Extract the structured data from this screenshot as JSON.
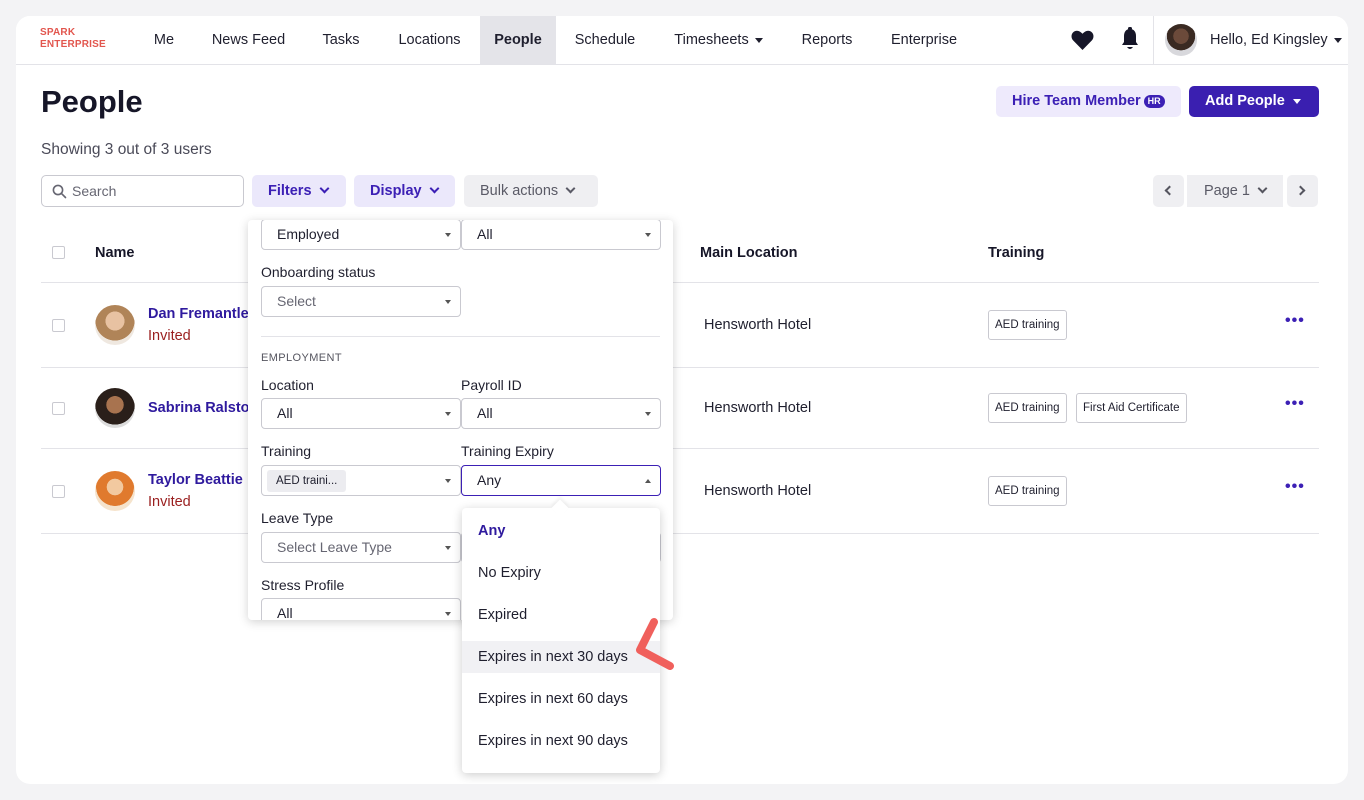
{
  "brand": {
    "line1": "SPARK",
    "line2": "ENTERPRISE",
    "color": "#e2564e"
  },
  "nav": {
    "items": [
      "Me",
      "News Feed",
      "Tasks",
      "Locations",
      "People",
      "Schedule",
      "Timesheets",
      "Reports",
      "Enterprise"
    ],
    "active": "People",
    "user_greeting": "Hello, Ed Kingsley",
    "icons": [
      "heart-icon",
      "bell-icon"
    ]
  },
  "header": {
    "title": "People",
    "hire_label": "Hire Team Member",
    "hire_badge": "HR",
    "add_label": "Add People",
    "showing": "Showing 3 out of 3 users"
  },
  "toolbar": {
    "search_placeholder": "Search",
    "filters_label": "Filters",
    "display_label": "Display",
    "bulk_label": "Bulk actions",
    "page_label": "Page 1"
  },
  "table": {
    "columns": {
      "name": "Name",
      "main_location": "Main Location",
      "training": "Training"
    },
    "rows": [
      {
        "name": "Dan Fremantle",
        "status": "Invited",
        "location": "Hensworth Hotel",
        "training": [
          "AED training"
        ]
      },
      {
        "name": "Sabrina Ralston",
        "status": "",
        "location": "Hensworth Hotel",
        "training": [
          "AED training",
          "First Aid Certificate"
        ]
      },
      {
        "name": "Taylor Beattie",
        "status": "Invited",
        "location": "Hensworth Hotel",
        "training": [
          "AED training"
        ]
      }
    ]
  },
  "filters": {
    "top_left_value": "Employed",
    "top_right_value": "All",
    "onboarding_label": "Onboarding status",
    "onboarding_value": "Select",
    "section_employment": "EMPLOYMENT",
    "location_label": "Location",
    "location_value": "All",
    "payroll_label": "Payroll ID",
    "payroll_value": "All",
    "training_label": "Training",
    "training_value": "AED traini...",
    "training_expiry_label": "Training Expiry",
    "training_expiry_value": "Any",
    "leave_label": "Leave Type",
    "leave_value": "Select Leave Type",
    "stress_label": "Stress Profile",
    "stress_value": "All"
  },
  "expiry_dropdown": {
    "options": [
      "Any",
      "No Expiry",
      "Expired",
      "Expires in next 30 days",
      "Expires in next 60 days",
      "Expires in next 90 days"
    ],
    "selected": "Any",
    "highlighted": "Expires in next 30 days"
  },
  "colors": {
    "accent": "#3c20b5",
    "invited": "#9a1f1f",
    "annotation": "#f0605c"
  }
}
